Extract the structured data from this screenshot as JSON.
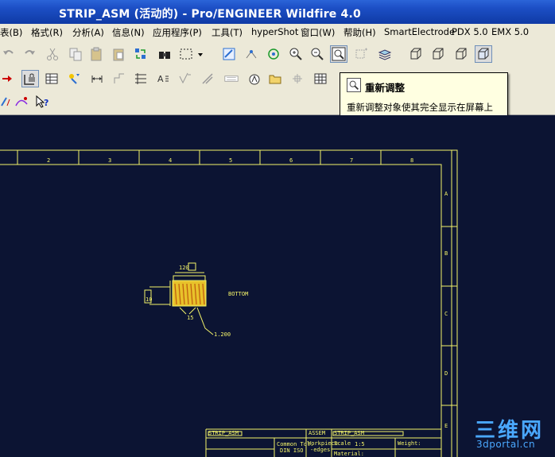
{
  "window": {
    "title": "STRIP_ASM (活动的) - Pro/ENGINEER Wildfire 4.0"
  },
  "menubar": {
    "items": [
      "表(B)",
      "格式(R)",
      "分析(A)",
      "信息(N)",
      "应用程序(P)",
      "工具(T)",
      "hyperShot",
      "窗口(W)",
      "帮助(H)",
      "SmartElectrode",
      "PDX 5.0",
      "EMX 5.0"
    ]
  },
  "tooltip": {
    "title": "重新调整",
    "description": "重新调整对象使其完全显示在屏幕上"
  },
  "drawing": {
    "column_labels": [
      "2",
      "3",
      "4",
      "5",
      "6",
      "7",
      "8"
    ],
    "row_labels": [
      "A",
      "B",
      "C",
      "D",
      "E"
    ],
    "dimensions": {
      "top": "120",
      "side": "10",
      "bottom": "15",
      "leader": "1.200"
    },
    "note": "BOTTOM",
    "title_block": {
      "part_name_left": "STRIP_ASM",
      "assem_label": "ASSEM",
      "part_name_right": "STRIP_ASM",
      "scale_label": "Scale",
      "scale_value": "1:5",
      "weight_label": "Weight:",
      "tolerance_label": "Common Tol.",
      "tolerance_std": "DIN ISO",
      "workpiece_label": "Workpiece",
      "workpiece_sub": "-edges",
      "material_label": "Material:"
    }
  },
  "watermark": {
    "main": "三维网",
    "sub": "3dportal.cn"
  },
  "colors": {
    "canvas": "#0c1433",
    "cad_line": "#f3f36a",
    "titlebar": "#1c4ec4"
  }
}
